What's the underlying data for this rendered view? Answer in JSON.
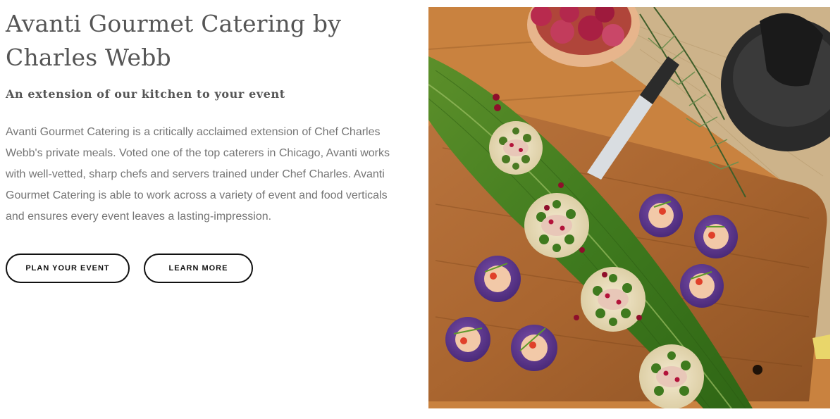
{
  "hero": {
    "title": "Avanti Gourmet Catering by Charles Webb",
    "subtitle": "An extension of our kitchen to your event",
    "description": "Avanti Gourmet Catering is a critically acclaimed extension of Chef Charles Webb's private meals. Voted one of the top caterers in Chicago, Avanti works with well-vetted, sharp chefs and servers trained under Chef Charles. Avanti Gourmet Catering is able to work across a variety of event and food verticals and ensures every event leaves a lasting-impression.",
    "buttons": {
      "plan_label": "PLAN YOUR EVENT",
      "learn_label": "LEARN MORE"
    }
  },
  "photo": {
    "subject": "catering-appetizers-on-leaf-photo"
  },
  "colors": {
    "text_heading": "#555555",
    "text_body": "#757575",
    "button_border": "#111111"
  }
}
